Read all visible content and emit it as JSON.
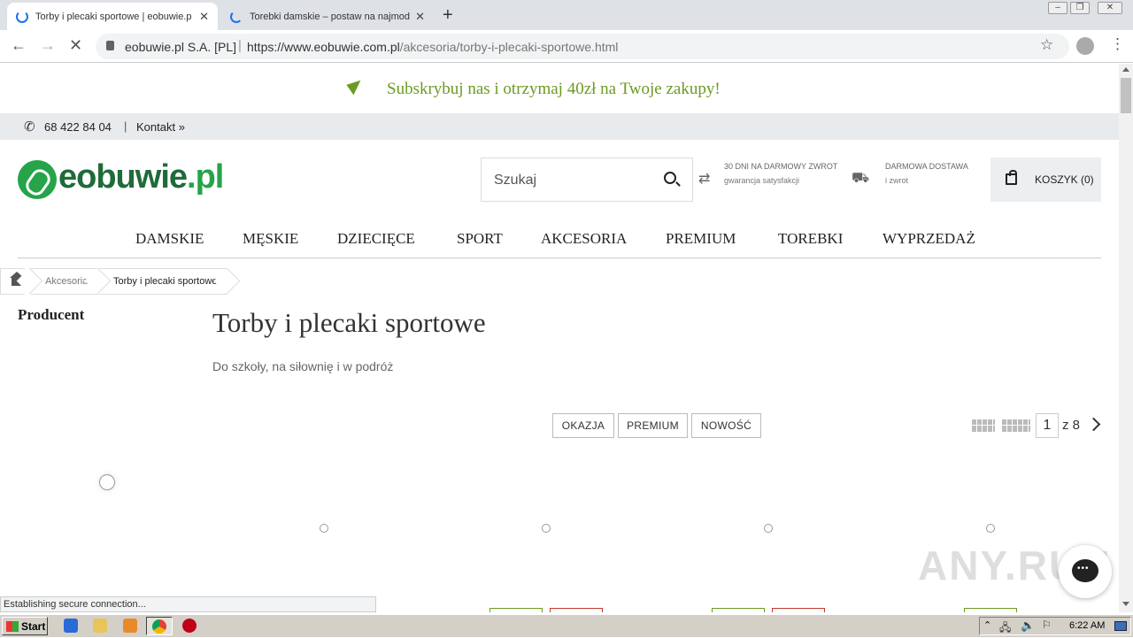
{
  "browser": {
    "tabs": [
      {
        "title": "Torby i plecaki sportowe | eobuwie.p",
        "active": true
      },
      {
        "title": "Torebki damskie – postaw na najmod",
        "active": false
      }
    ],
    "new_tab": "+",
    "site_identity": "eobuwie.pl S.A. [PL]",
    "url_host": "https://www.eobuwie.com.pl",
    "url_path": "/akcesoria/torby-i-plecaki-sportowe.html",
    "status_text": "Establishing secure connection..."
  },
  "promo": {
    "text": "Subskrybuj nas i otrzymaj 40zł na Twoje zakupy!",
    "color": "#6b9b22"
  },
  "contact": {
    "phone": "68 422 84 04",
    "separator": "|",
    "link": "Kontakt »"
  },
  "logo": {
    "main": "eobuwie",
    "suffix": ".pl"
  },
  "search": {
    "placeholder": "Szukaj"
  },
  "usp": [
    {
      "icon": "return-arrows-icon",
      "title": "30 DNI NA DARMOWY ZWROT",
      "subtitle": "gwarancja satysfakcji"
    },
    {
      "icon": "delivery-truck-icon",
      "title": "DARMOWA DOSTAWA",
      "subtitle": "i zwrot"
    }
  ],
  "cart": {
    "label": "KOSZYK (0)"
  },
  "nav": [
    "DAMSKIE",
    "MĘSKIE",
    "DZIECIĘCE",
    "SPORT",
    "AKCESORIA",
    "PREMIUM",
    "TOREBKI",
    "WYPRZEDAŻ"
  ],
  "breadcrumb": [
    "Akcesoria",
    "Torby i plecaki sportowe"
  ],
  "filters": {
    "title": "Producent"
  },
  "category": {
    "title": "Torby i plecaki sportowe",
    "subtitle": "Do szkoły, na siłownię i w podróż"
  },
  "tags": [
    "OKAZJA",
    "PREMIUM",
    "NOWOŚĆ"
  ],
  "pagination": {
    "current": "1",
    "of_text": "z 8"
  },
  "watermark": "ANY.RUN",
  "taskbar": {
    "start": "Start",
    "clock": "6:22 AM"
  },
  "colors": {
    "brand_green": "#25a449",
    "brand_dark": "#1f6b3a",
    "chrome_blue": "#1a73e8"
  }
}
